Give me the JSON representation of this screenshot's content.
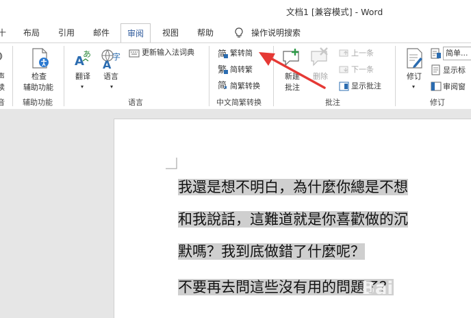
{
  "window": {
    "title": "文档1 [兼容模式] - Word"
  },
  "tabs": [
    {
      "label": "十"
    },
    {
      "label": "布局"
    },
    {
      "label": "引用"
    },
    {
      "label": "邮件"
    },
    {
      "label": "审阅"
    },
    {
      "label": "视图"
    },
    {
      "label": "帮助"
    },
    {
      "label": "操作说明搜索"
    }
  ],
  "ribbon": {
    "partial_left": {
      "line1": "声",
      "line2": "读",
      "group": "音"
    },
    "accessibility": {
      "button": "检查\n辅助功能",
      "line1": "检查",
      "line2": "辅助功能",
      "group": "辅助功能"
    },
    "language": {
      "translate": "翻译",
      "language": "语言",
      "update_ime": "更新输入法词典",
      "group": "语言"
    },
    "chinese_conversion": {
      "trad_to_simp": "繁转简",
      "simp_to_trad": "简转繁",
      "convert": "简繁转换",
      "group": "中文简繁转换"
    },
    "comments": {
      "new_line1": "新建",
      "new_line2": "批注",
      "delete": "删除",
      "previous": "上一条",
      "next": "下一条",
      "show": "显示批注",
      "group": "批注"
    },
    "tracking": {
      "track": "修订",
      "markup_dropdown": "简单...",
      "show_markup": "显示标",
      "review_pane": "审阅窗",
      "group": "修订"
    }
  },
  "document": {
    "lines": [
      "我還是想不明白，為什麼你總是不想",
      "和我說話，這難道就是你喜歡做的沉",
      "默嗎？我到底做錯了什麼呢？",
      "不要再去問這些沒有用的問題了？"
    ]
  },
  "colors": {
    "accent": "#2b579a",
    "arrow": "#e53935",
    "selection": "#cfcfcf"
  }
}
